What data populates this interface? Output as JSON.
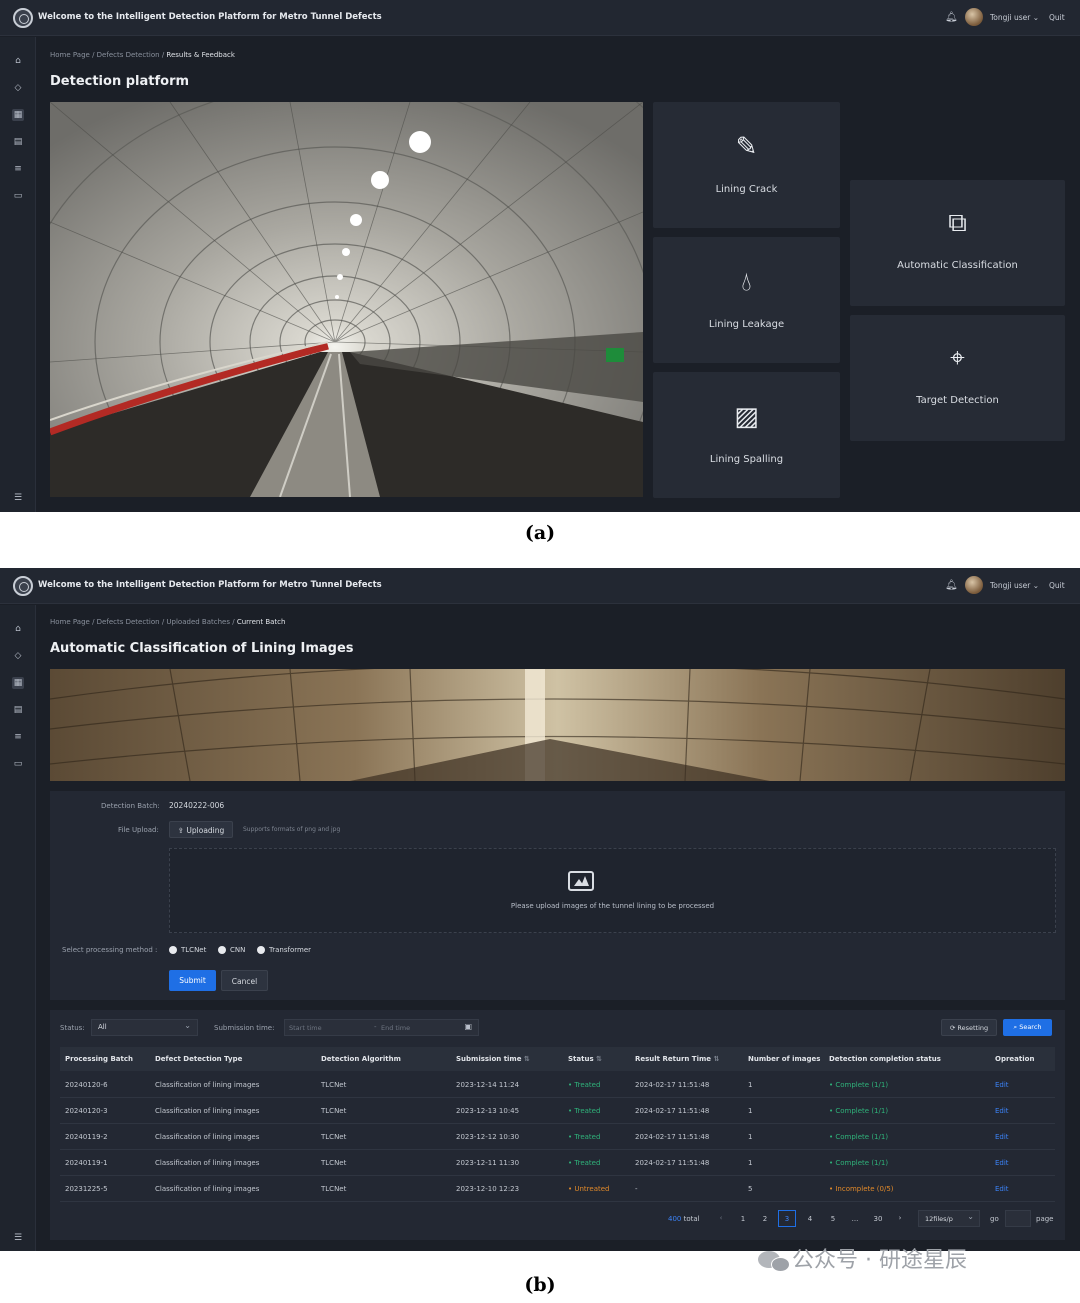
{
  "app_title": "Welcome to the Intelligent Detection Platform for Metro Tunnel Defects",
  "user_name": "Tongji user",
  "user_chevron": "⌄",
  "quit_label": "Quit",
  "panel_a": {
    "breadcrumb": [
      "Home Page",
      "Defects Detection",
      "Results & Feedback"
    ],
    "title": "Detection platform",
    "cards": {
      "lining_crack": "Lining Crack",
      "lining_leakage": "Lining Leakage",
      "lining_spalling": "Lining Spalling",
      "automatic_classification": "Automatic Classification",
      "target_detection": "Target Detection"
    }
  },
  "caption_a": "(a)",
  "panel_b": {
    "breadcrumb": [
      "Home Page",
      "Defects Detection",
      "Uploaded Batches",
      "Current Batch"
    ],
    "title": "Automatic Classification of Lining Images",
    "form": {
      "batch_label": "Detection Batch:",
      "batch_value": "20240222-006",
      "upload_label": "File Upload:",
      "upload_button": "Uploading",
      "upload_hint": "Supports formats of png and jpg",
      "dropzone_text": "Please upload images of the tunnel lining to be processed",
      "method_label": "Select processing method :",
      "methods": [
        "TLCNet",
        "CNN",
        "Transformer"
      ],
      "submit": "Submit",
      "cancel": "Cancel"
    },
    "filters": {
      "status_label": "Status:",
      "status_value": "All",
      "time_label": "Submission time:",
      "start_placeholder": "Start time",
      "sep": "-",
      "end_placeholder": "End time",
      "reset": "Resetting",
      "search": "Search"
    },
    "table": {
      "headers": [
        "Processing Batch",
        "Defect Detection Type",
        "Detection Algorithm",
        "Submission time",
        "Status",
        "Result Return Time",
        "Number of images",
        "Detection completion status",
        "Opreation"
      ],
      "rows": [
        [
          "20240120-6",
          "Classification of lining images",
          "TLCNet",
          "2023-12-14 11:24",
          "Treated",
          "2024-02-17 11:51:48",
          "1",
          "Complete (1/1)",
          "Edit"
        ],
        [
          "20240120-3",
          "Classification of lining images",
          "TLCNet",
          "2023-12-13 10:45",
          "Treated",
          "2024-02-17 11:51:48",
          "1",
          "Complete (1/1)",
          "Edit"
        ],
        [
          "20240119-2",
          "Classification of lining images",
          "TLCNet",
          "2023-12-12 10:30",
          "Treated",
          "2024-02-17 11:51:48",
          "1",
          "Complete (1/1)",
          "Edit"
        ],
        [
          "20240119-1",
          "Classification of lining images",
          "TLCNet",
          "2023-12-11 11:30",
          "Treated",
          "2024-02-17 11:51:48",
          "1",
          "Complete (1/1)",
          "Edit"
        ],
        [
          "20231225-5",
          "Classification of lining images",
          "TLCNet",
          "2023-12-10 12:23",
          "Untreated",
          "-",
          "5",
          "Incomplete (0/5)",
          "Edit"
        ]
      ]
    },
    "pagination": {
      "total_count": "400",
      "total_label": "total",
      "prev": "‹",
      "pages": [
        "1",
        "2",
        "3",
        "4",
        "5",
        "...",
        "30"
      ],
      "current": "3",
      "next": "›",
      "per_page": "12files/p",
      "go_label": "go",
      "page_label": "page"
    }
  },
  "caption_b": "(b)",
  "watermark": "公众号 · 研途星辰",
  "colors": {
    "bg": "#1b1f27",
    "panel": "#232833",
    "card": "#262b35",
    "primary": "#1f6fe5",
    "success": "#2fb27a",
    "warning": "#e0892a"
  }
}
